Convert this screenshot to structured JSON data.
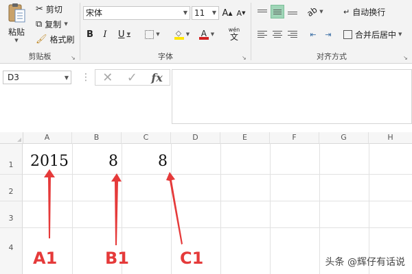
{
  "ribbon": {
    "clipboard": {
      "label": "剪贴板",
      "paste": "粘贴",
      "cut": "剪切",
      "copy": "复制",
      "format_painter": "格式刷"
    },
    "font": {
      "label": "字体",
      "font_name": "宋体",
      "font_size": "11",
      "bold": "B",
      "italic": "I",
      "underline": "U",
      "grow": "A",
      "shrink": "A",
      "font_color_letter": "A",
      "wen": "wén",
      "wen_char": "文"
    },
    "alignment": {
      "label": "对齐方式",
      "wrap_text": "自动换行",
      "merge_center": "合并后居中"
    }
  },
  "formula_bar": {
    "name_box": "D3",
    "fx": "fx"
  },
  "sheet": {
    "columns": [
      "A",
      "B",
      "C",
      "D",
      "E",
      "F",
      "G",
      "H"
    ],
    "rows": [
      "1",
      "2",
      "3",
      "4"
    ],
    "cells": {
      "A1": "2015",
      "B1": "8",
      "C1": "8"
    }
  },
  "annotations": {
    "a1": "A1",
    "b1": "B1",
    "c1": "C1",
    "color": "#e53a3a"
  },
  "watermark": "头条 @辉仔有话说",
  "colors": {
    "ribbon_bg": "#f3f3f3",
    "active_align": "#9fd5b7",
    "font_color_bar": "#d02020",
    "highlight_bar": "#ffe600"
  }
}
